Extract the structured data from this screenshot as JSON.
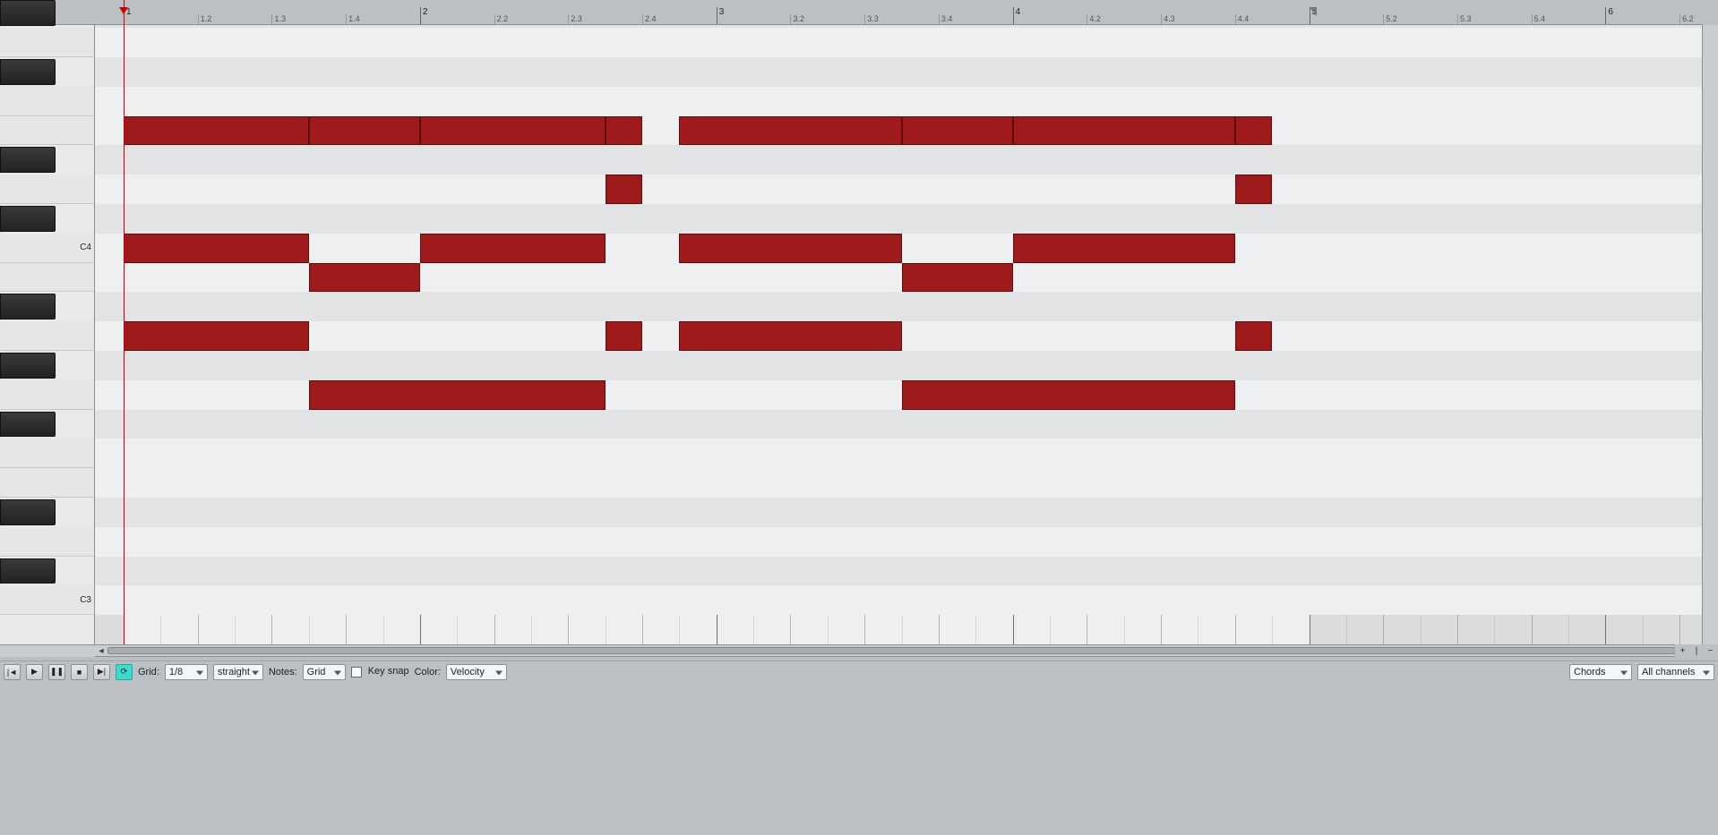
{
  "grid": {
    "pxOriginX": 138,
    "pianoWidth": 106,
    "rowHeight": 32.8,
    "sixteenthPx": 20.68,
    "bars": 5,
    "beatsPerBar": 4,
    "subsPerBeat": 2,
    "loopEndBar": 5,
    "playheadBar": 1
  },
  "keyLabels": {
    "C4": "C4",
    "C3": "C3"
  },
  "notes": [
    {
      "pitch": "E4",
      "start": 0,
      "length": 10
    },
    {
      "pitch": "E4",
      "start": 10,
      "length": 6
    },
    {
      "pitch": "E4",
      "start": 16,
      "length": 10
    },
    {
      "pitch": "E4",
      "start": 26,
      "length": 2
    },
    {
      "pitch": "E4",
      "start": 30,
      "length": 12
    },
    {
      "pitch": "E4",
      "start": 42,
      "length": 6
    },
    {
      "pitch": "E4",
      "start": 48,
      "length": 12
    },
    {
      "pitch": "E4",
      "start": 60,
      "length": 2
    },
    {
      "pitch": "D4",
      "start": 26,
      "length": 2
    },
    {
      "pitch": "D4",
      "start": 60,
      "length": 2
    },
    {
      "pitch": "C4",
      "start": 0,
      "length": 10
    },
    {
      "pitch": "C4",
      "start": 16,
      "length": 10
    },
    {
      "pitch": "C4",
      "start": 30,
      "length": 12
    },
    {
      "pitch": "C4",
      "start": 48,
      "length": 12
    },
    {
      "pitch": "B3",
      "start": 10,
      "length": 6
    },
    {
      "pitch": "B3",
      "start": 42,
      "length": 6
    },
    {
      "pitch": "A3",
      "start": 0,
      "length": 10
    },
    {
      "pitch": "A3",
      "start": 26,
      "length": 2
    },
    {
      "pitch": "A3",
      "start": 30,
      "length": 12
    },
    {
      "pitch": "A3",
      "start": 60,
      "length": 2
    },
    {
      "pitch": "G3",
      "start": 10,
      "length": 16
    },
    {
      "pitch": "G3",
      "start": 42,
      "length": 18
    }
  ],
  "pitchOrder": [
    "B4",
    "A#4",
    "A4",
    "G#4",
    "G4",
    "F#4",
    "F4",
    "E4",
    "D#4",
    "D4",
    "C#4",
    "C4",
    "B3",
    "A#3",
    "A3",
    "G#3",
    "G3",
    "F#3",
    "F3",
    "E3",
    "D#3",
    "D3",
    "C#3",
    "C3"
  ],
  "blackPitches": [
    "A#4",
    "G#4",
    "F#4",
    "D#4",
    "C#4",
    "A#3",
    "G#3",
    "F#3",
    "D#3",
    "C#3"
  ],
  "rowOffsetFirst": -128,
  "status": {
    "gridLabel": "Grid:",
    "gridValue": "1/8",
    "swing": "straight",
    "notesLabel": "Notes:",
    "notesValue": "Grid",
    "keySnap": "Key snap",
    "colorLabel": "Color:",
    "colorValue": "Velocity",
    "chordLink": "Chords",
    "channel": "All channels"
  }
}
